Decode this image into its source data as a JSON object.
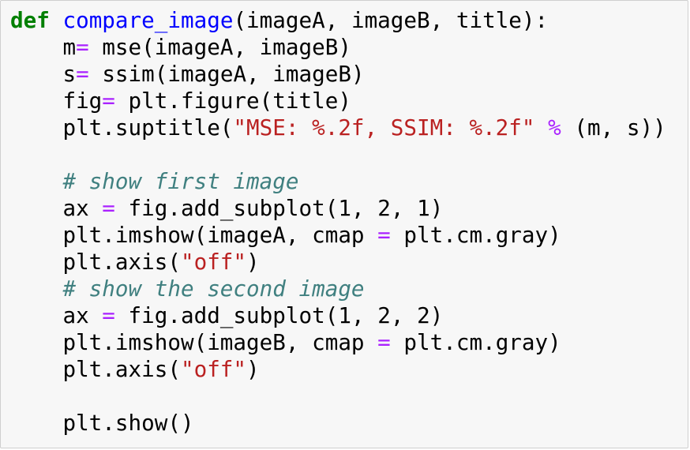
{
  "code": {
    "lines": [
      [
        {
          "t": "kw",
          "v": "def"
        },
        {
          "t": "pl",
          "v": " "
        },
        {
          "t": "fn",
          "v": "compare_image"
        },
        {
          "t": "pl",
          "v": "(imageA, imageB, title):"
        }
      ],
      [
        {
          "t": "pl",
          "v": "    m"
        },
        {
          "t": "op",
          "v": "="
        },
        {
          "t": "pl",
          "v": " mse(imageA, imageB)"
        }
      ],
      [
        {
          "t": "pl",
          "v": "    s"
        },
        {
          "t": "op",
          "v": "="
        },
        {
          "t": "pl",
          "v": " ssim(imageA, imageB)"
        }
      ],
      [
        {
          "t": "pl",
          "v": "    fig"
        },
        {
          "t": "op",
          "v": "="
        },
        {
          "t": "pl",
          "v": " plt.figure(title)"
        }
      ],
      [
        {
          "t": "pl",
          "v": "    plt.suptitle("
        },
        {
          "t": "str",
          "v": "\"MSE: %.2f, SSIM: %.2f\""
        },
        {
          "t": "pl",
          "v": " "
        },
        {
          "t": "op",
          "v": "%"
        },
        {
          "t": "pl",
          "v": " (m, s))"
        }
      ],
      [],
      [
        {
          "t": "pl",
          "v": "    "
        },
        {
          "t": "cm",
          "v": "# show first image"
        }
      ],
      [
        {
          "t": "pl",
          "v": "    ax "
        },
        {
          "t": "op",
          "v": "="
        },
        {
          "t": "pl",
          "v": " fig.add_subplot("
        },
        {
          "t": "num",
          "v": "1"
        },
        {
          "t": "pl",
          "v": ", "
        },
        {
          "t": "num",
          "v": "2"
        },
        {
          "t": "pl",
          "v": ", "
        },
        {
          "t": "num",
          "v": "1"
        },
        {
          "t": "pl",
          "v": ")"
        }
      ],
      [
        {
          "t": "pl",
          "v": "    plt.imshow(imageA, cmap "
        },
        {
          "t": "op",
          "v": "="
        },
        {
          "t": "pl",
          "v": " plt.cm.gray)"
        }
      ],
      [
        {
          "t": "pl",
          "v": "    plt.axis("
        },
        {
          "t": "str",
          "v": "\"off\""
        },
        {
          "t": "pl",
          "v": ")"
        }
      ],
      [
        {
          "t": "pl",
          "v": "    "
        },
        {
          "t": "cm",
          "v": "# show the second image"
        }
      ],
      [
        {
          "t": "pl",
          "v": "    ax "
        },
        {
          "t": "op",
          "v": "="
        },
        {
          "t": "pl",
          "v": " fig.add_subplot("
        },
        {
          "t": "num",
          "v": "1"
        },
        {
          "t": "pl",
          "v": ", "
        },
        {
          "t": "num",
          "v": "2"
        },
        {
          "t": "pl",
          "v": ", "
        },
        {
          "t": "num",
          "v": "2"
        },
        {
          "t": "pl",
          "v": ")"
        }
      ],
      [
        {
          "t": "pl",
          "v": "    plt.imshow(imageB, cmap "
        },
        {
          "t": "op",
          "v": "="
        },
        {
          "t": "pl",
          "v": " plt.cm.gray)"
        }
      ],
      [
        {
          "t": "pl",
          "v": "    plt.axis("
        },
        {
          "t": "str",
          "v": "\"off\""
        },
        {
          "t": "pl",
          "v": ")"
        }
      ],
      [],
      [
        {
          "t": "pl",
          "v": "    plt.show()"
        }
      ]
    ]
  },
  "colors": {
    "keyword": "#008000",
    "function_name": "#0000ff",
    "operator": "#aa22ff",
    "string": "#ba2121",
    "comment": "#408080",
    "background": "#f7f7f7",
    "border": "#cfcfcf"
  }
}
